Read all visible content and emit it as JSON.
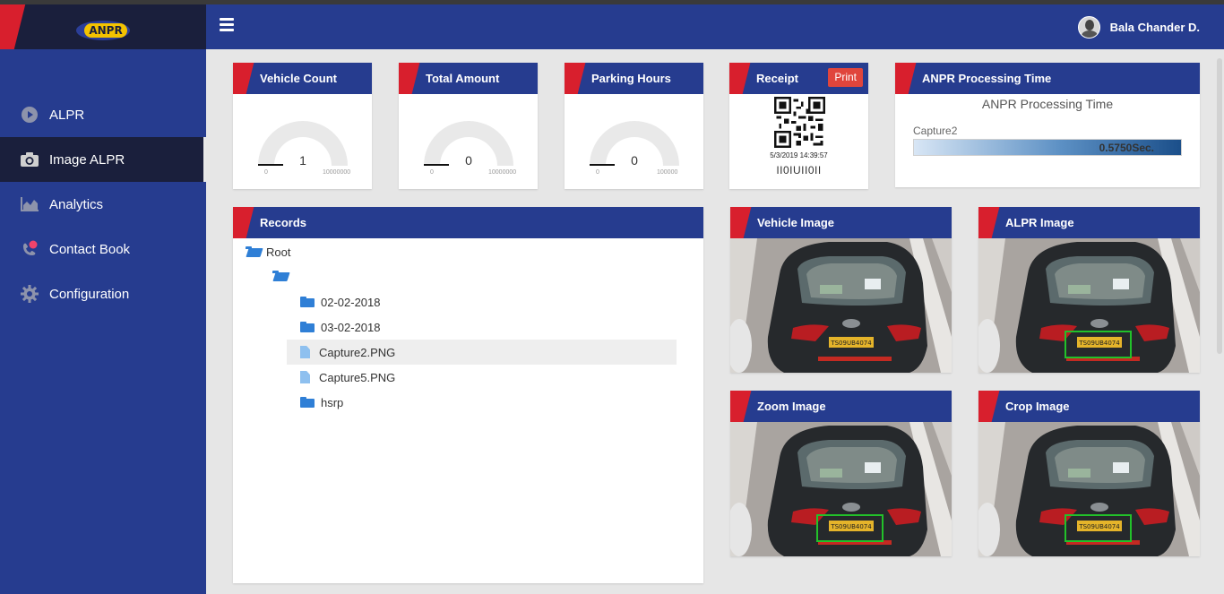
{
  "app": {
    "logo_text": "ANPR",
    "colors": {
      "primary": "#263c8f",
      "accent_red": "#d81f2d",
      "dark": "#1a1f3c"
    }
  },
  "header": {
    "menu_icon": "hamburger-icon",
    "user_name": "Bala Chander D."
  },
  "sidebar": {
    "items": [
      {
        "label": "ALPR",
        "icon": "play-circle-icon",
        "active": false
      },
      {
        "label": "Image ALPR",
        "icon": "camera-icon",
        "active": true
      },
      {
        "label": "Analytics",
        "icon": "area-chart-icon",
        "active": false
      },
      {
        "label": "Contact Book",
        "icon": "phone-icon",
        "active": false
      },
      {
        "label": "Configuration",
        "icon": "gear-icon",
        "active": false
      }
    ]
  },
  "cards": {
    "vehicle_count": {
      "title": "Vehicle Count",
      "value": "1",
      "min": "0",
      "max": "10000000"
    },
    "total_amount": {
      "title": "Total Amount",
      "value": "0",
      "min": "0",
      "max": "10000000"
    },
    "parking_hours": {
      "title": "Parking Hours",
      "value": "0",
      "min": "0",
      "max": "100000"
    },
    "receipt": {
      "title": "Receipt",
      "print_label": "Print",
      "date": "5/3/2019 14:39:57",
      "code": "II0IUII0II"
    },
    "processing": {
      "title": "ANPR Processing Time",
      "subtitle": "ANPR Processing Time",
      "label": "Capture2",
      "value": "0.5750Sec."
    }
  },
  "records": {
    "title": "Records",
    "tree": [
      {
        "label": "Root",
        "type": "folder-open"
      },
      {
        "label": "",
        "type": "folder-open"
      },
      {
        "label": "02-02-2018",
        "type": "folder"
      },
      {
        "label": "03-02-2018",
        "type": "folder"
      },
      {
        "label": "Capture2.PNG",
        "type": "file",
        "selected": true
      },
      {
        "label": "Capture5.PNG",
        "type": "file"
      },
      {
        "label": "hsrp",
        "type": "folder"
      }
    ]
  },
  "images": {
    "vehicle": {
      "title": "Vehicle Image"
    },
    "alpr": {
      "title": "ALPR Image"
    },
    "zoom": {
      "title": "Zoom Image"
    },
    "crop": {
      "title": "Crop Image"
    },
    "plate_text": "TS09UB4074"
  }
}
